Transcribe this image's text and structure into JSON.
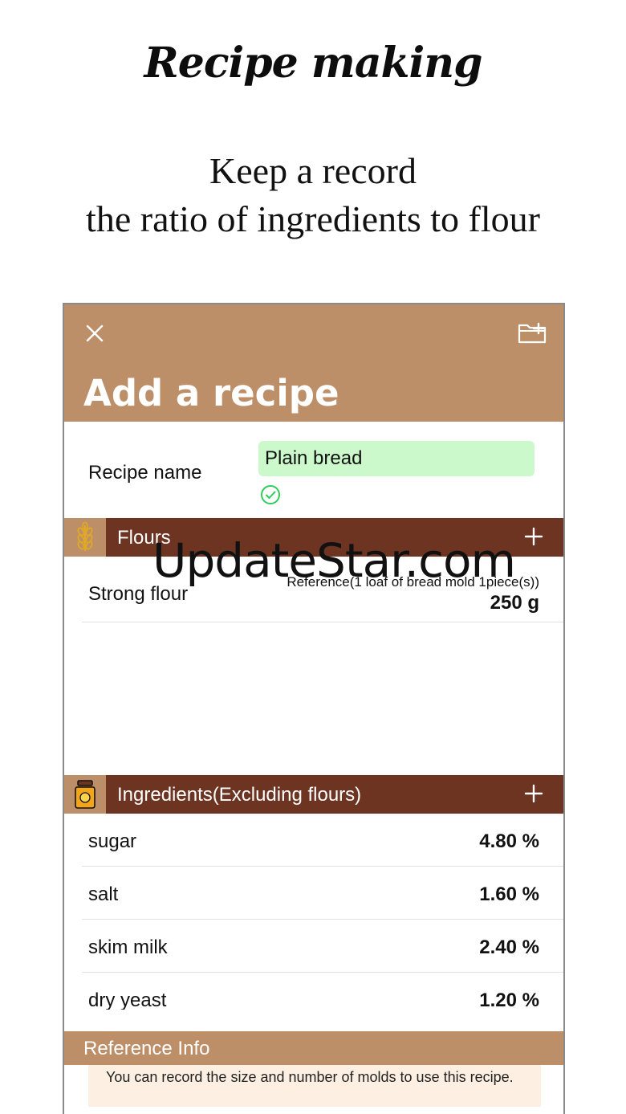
{
  "promo": {
    "title": "Recipe making",
    "subtitle_line1": "Keep a record",
    "subtitle_line2": "the ratio of ingredients to flour"
  },
  "header": {
    "title": "Add a recipe",
    "close_icon": "close-icon",
    "folder_icon": "folder-add-icon",
    "color": "#bd8f69"
  },
  "recipe_name": {
    "label": "Recipe name",
    "value": "Plain bread",
    "input_bg": "#ccf9cb"
  },
  "flours": {
    "title": "Flours",
    "icon": "wheat-icon",
    "items": [
      {
        "name": "Strong flour",
        "reference": "Reference(1 loaf of bread mold 1piece(s))",
        "amount": "250 g"
      }
    ]
  },
  "ingredients": {
    "title": "Ingredients(Excluding flours)",
    "icon": "jar-icon",
    "items": [
      {
        "name": "sugar",
        "value": "4.80 %"
      },
      {
        "name": "salt",
        "value": "1.60 %"
      },
      {
        "name": "skim milk",
        "value": "2.40 %"
      },
      {
        "name": "dry yeast",
        "value": "1.20 %"
      }
    ]
  },
  "reference_info": {
    "title": "Reference Info",
    "text": "You can record the size and number of molds to use this recipe."
  },
  "watermark": "UpdateStar.com",
  "colors": {
    "section_dark": "#6d3422",
    "section_light": "#bd8f69",
    "note_bg": "#fdf0e2"
  }
}
